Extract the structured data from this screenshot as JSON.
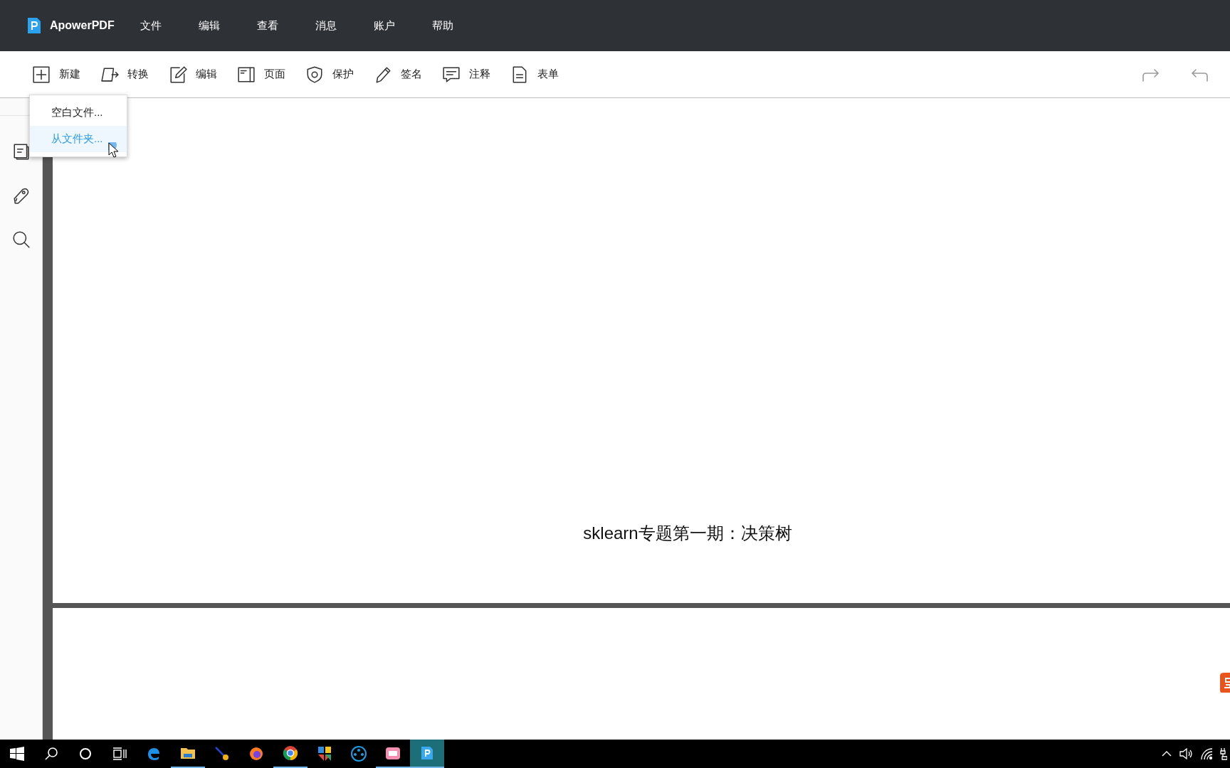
{
  "app": {
    "name": "ApowerPDF"
  },
  "menu": [
    "文件",
    "编辑",
    "查看",
    "消息",
    "账户",
    "帮助"
  ],
  "toolbar": [
    {
      "label": "新建"
    },
    {
      "label": "转换"
    },
    {
      "label": "编辑"
    },
    {
      "label": "页面"
    },
    {
      "label": "保护"
    },
    {
      "label": "签名"
    },
    {
      "label": "注释"
    },
    {
      "label": "表单"
    }
  ],
  "history": [
    {
      "disabled": true
    },
    {
      "disabled": true
    }
  ],
  "dropdown": [
    {
      "label": "空白文件...",
      "selected": false
    },
    {
      "label": "从文件夹...",
      "selected": true
    }
  ],
  "document": {
    "title": "sklearn专题第一期：决策树"
  },
  "taskbar": [
    {
      "running": false,
      "selected": false
    },
    {
      "running": true,
      "selected": false
    },
    {
      "running": false,
      "selected": false
    },
    {
      "running": false,
      "selected": false
    },
    {
      "running": true,
      "selected": false
    },
    {
      "running": false,
      "selected": false
    },
    {
      "running": false,
      "selected": false
    },
    {
      "running": true,
      "selected": false
    },
    {
      "running": true,
      "selected": true
    }
  ]
}
